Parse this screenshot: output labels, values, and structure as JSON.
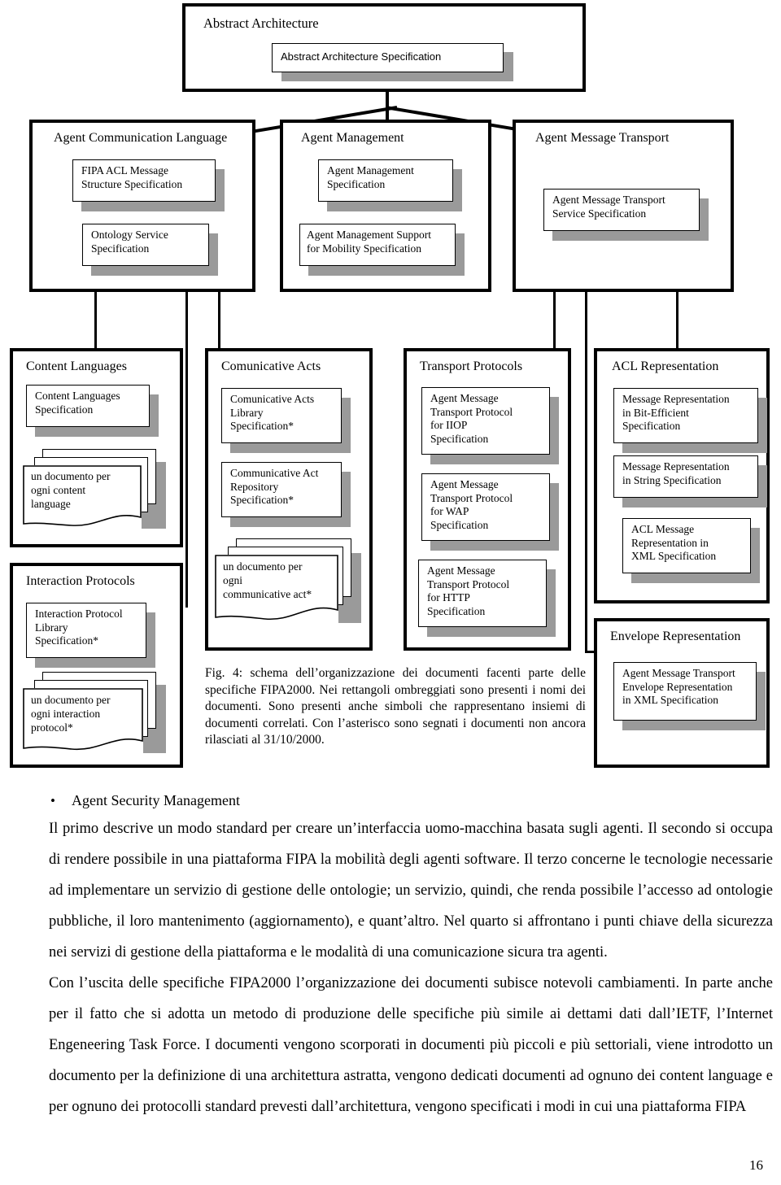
{
  "diagram": {
    "root": {
      "title": "Abstract Architecture",
      "docs": [
        "Abstract Architecture Specification"
      ]
    },
    "row2": [
      {
        "title": "Agent Communication Language",
        "docs": [
          "FIPA ACL Message\nStructure Specification",
          "Ontology Service\nSpecification"
        ]
      },
      {
        "title": "Agent Management",
        "docs": [
          "Agent Management\nSpecification",
          "Agent Management Support\nfor Mobility Specification"
        ]
      },
      {
        "title": "Agent Message Transport",
        "docs": [
          "Agent Message Transport\nService Specification"
        ]
      }
    ],
    "row3": [
      {
        "title": "Content Languages",
        "docs": [
          "Content Languages\nSpecification"
        ],
        "stack": "un documento per\nogni content\nlanguage"
      },
      {
        "title": "Comunicative Acts",
        "docs": [
          "Comunicative Acts\nLibrary\nSpecification*",
          "Communicative Act\nRepository\nSpecification*"
        ],
        "stack": "un documento per\nogni\ncommunicative act*"
      },
      {
        "title": "Transport Protocols",
        "docs": [
          "Agent Message\nTransport Protocol\nfor IIOP\nSpecification",
          "Agent Message\nTransport Protocol\nfor WAP\nSpecification",
          "Agent Message\nTransport Protocol\nfor HTTP\nSpecification"
        ],
        "stack": null
      },
      {
        "title": "ACL Representation",
        "docs": [
          "Message Representation\nin Bit-Efficient\nSpecification",
          "Message Representation\nin String Specification",
          "ACL Message\nRepresentation in\nXML Specification"
        ],
        "stack": null
      }
    ],
    "row4": [
      {
        "title": "Interaction Protocols",
        "docs": [
          "Interaction Protocol\nLibrary\nSpecification*"
        ],
        "stack": "un documento per\nogni interaction\nprotocol*"
      },
      {
        "title": "Envelope Representation",
        "docs": [
          "Agent Message Transport\nEnvelope Representation\nin XML Specification"
        ],
        "stack": null
      }
    ],
    "caption": "Fig. 4: schema dell’organizzazione dei documenti facenti parte delle specifiche FIPA2000. Nei rettangoli ombreggiati sono presenti i nomi dei documenti. Sono presenti anche simboli che rappresentano insiemi di documenti correlati. Con l’asterisco sono segnati i documenti non ancora rilasciati al 31/10/2000."
  },
  "body": {
    "bullet_symbol": "•",
    "bullet_text": "Agent Security Management",
    "paragraph1": "Il primo descrive un modo standard per creare un’interfaccia uomo-macchina basata sugli agenti. Il secondo si occupa di rendere possibile in una piattaforma FIPA la mobilità degli agenti software. Il terzo concerne le tecnologie necessarie ad implementare un servizio di gestione delle ontologie; un servizio, quindi, che renda possibile l’accesso ad ontologie pubbliche, il loro mantenimento (aggiornamento), e quant’altro. Nel quarto si affrontano i punti chiave della sicurezza nei servizi di gestione della piattaforma e le modalità di una comunicazione sicura tra agenti.",
    "paragraph2": "Con l’uscita delle specifiche FIPA2000 l’organizzazione dei documenti subisce notevoli cambiamenti. In parte anche per il fatto che si adotta un metodo di produzione delle specifiche più simile ai dettami dati dall’IETF, l’Internet Engeneering Task Force. I documenti vengono scorporati in documenti più piccoli e più settoriali, viene introdotto un documento per la definizione di una architettura astratta, vengono dedicati documenti ad ognuno dei content language e per ognuno dei protocolli standard prevesti dall’architettura, vengono specificati i modi in cui una piattaforma FIPA",
    "page_number": "16"
  },
  "colors": {
    "shadow": "#9a9a9a",
    "line": "#000000",
    "background": "#ffffff"
  }
}
